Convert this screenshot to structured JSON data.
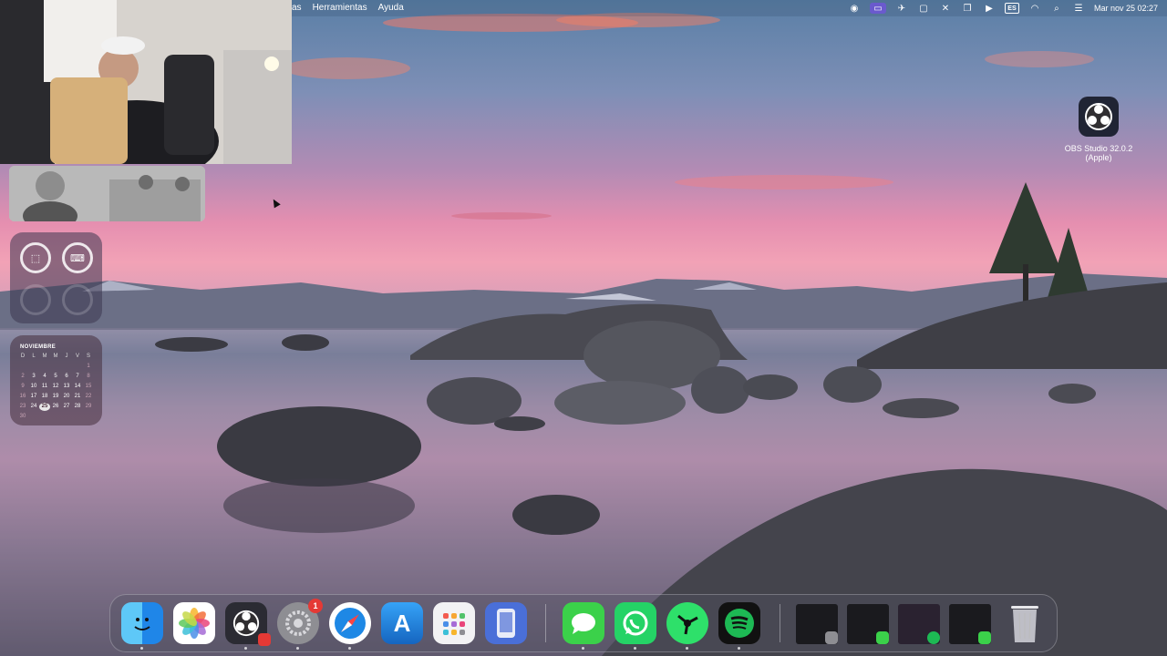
{
  "menubar": {
    "items": [
      "as",
      "Herramientas",
      "Ayuda"
    ],
    "lang_indicator": "ES",
    "clock": "Mar nov 25  02:27",
    "status_icons": [
      "obs-icon",
      "screen-record-icon",
      "vpn-icon",
      "display-icon",
      "mute-icon",
      "window-icon",
      "play-icon",
      "input-source-icon",
      "wifi-icon",
      "spotlight-icon",
      "control-center-icon"
    ]
  },
  "desktop_icon": {
    "label_line1": "OBS Studio 32.0.2",
    "label_line2": "(Apple)",
    "icon": "obs-icon"
  },
  "calendar_widget": {
    "month": "NOVIEMBRE",
    "weekdays": [
      "D",
      "L",
      "M",
      "M",
      "J",
      "V",
      "S"
    ],
    "today": "25",
    "days": [
      "",
      "",
      "",
      "",
      "",
      "",
      "1",
      "2",
      "3",
      "4",
      "5",
      "6",
      "7",
      "8",
      "9",
      "10",
      "11",
      "12",
      "13",
      "14",
      "15",
      "16",
      "17",
      "18",
      "19",
      "20",
      "21",
      "22",
      "23",
      "24",
      "25",
      "26",
      "27",
      "28",
      "29",
      "30",
      "",
      "",
      "",
      "",
      "",
      ""
    ]
  },
  "battery_widget": {
    "items": [
      {
        "icon": "mouse-icon",
        "fill": 0.8
      },
      {
        "icon": "keyboard-icon",
        "fill": 0.9
      }
    ]
  },
  "dock": {
    "apps": [
      {
        "name": "Finder",
        "icon": "finder-icon",
        "running": true
      },
      {
        "name": "Fotos",
        "icon": "photos-icon",
        "running": false
      },
      {
        "name": "OBS",
        "icon": "obs-icon",
        "running": true
      },
      {
        "name": "Ajustes",
        "icon": "settings-icon",
        "running": true,
        "badge": "1"
      },
      {
        "name": "Safari",
        "icon": "safari-icon",
        "running": true
      },
      {
        "name": "App Store",
        "icon": "appstore-icon",
        "running": false
      },
      {
        "name": "Launchpad",
        "icon": "launchpad-icon",
        "running": false
      },
      {
        "name": "Simulator",
        "icon": "simulator-icon",
        "running": false
      },
      {
        "name": "Mensajes",
        "icon": "messages-icon",
        "running": true
      },
      {
        "name": "WhatsApp",
        "icon": "whatsapp-icon",
        "running": true
      },
      {
        "name": "Spark",
        "icon": "spark-icon",
        "running": true
      },
      {
        "name": "Spotify",
        "icon": "spotify-icon",
        "running": true
      }
    ],
    "minimized": [
      "window-thumb-1",
      "window-thumb-2",
      "window-thumb-3",
      "window-thumb-4"
    ],
    "trash": "trash-icon"
  },
  "colors": {
    "messages": "#3bd14a",
    "whatsapp": "#25d366",
    "spark": "#2ee06a",
    "spotify": "#1db954",
    "safari": "#1e88e5",
    "appstore": "#1976d2",
    "badge": "#e53935"
  }
}
